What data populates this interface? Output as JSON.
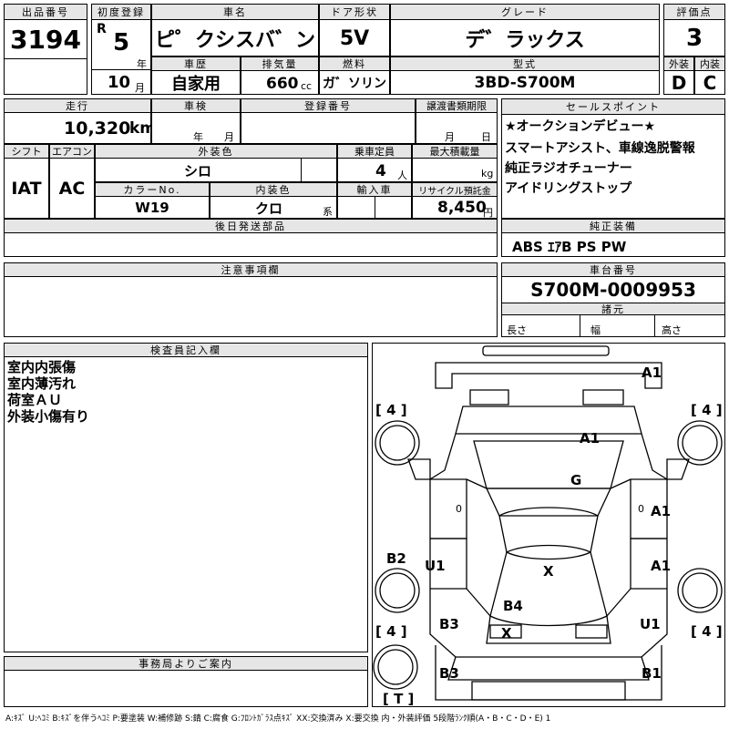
{
  "headers": {
    "lot_no": "出品番号",
    "first_reg": "初度登録",
    "car_name": "車名",
    "door_type": "ドア形状",
    "grade": "グレード",
    "rating": "評価点",
    "history": "車歴",
    "displacement": "排気量",
    "fuel": "燃料",
    "model": "型式",
    "exterior": "外装",
    "interior": "内装",
    "mileage": "走行",
    "inspection": "車検",
    "registration_no": "登録番号",
    "transfer_deadline": "譲渡書類期限",
    "sales_point": "セールスポイント",
    "shift": "シフト",
    "aircon": "エアコン",
    "exterior_color": "外装色",
    "capacity": "乗車定員",
    "max_load": "最大積載量",
    "color_no": "カラーNo.",
    "interior_color": "内装色",
    "import": "輸入車",
    "recycle": "リサイクル預託金",
    "later_parts": "後日発送部品",
    "genuine_equipment": "純正装備",
    "notes": "注意事項欄",
    "chassis_no": "車台番号",
    "specs": "諸元",
    "length": "長さ",
    "width": "幅",
    "height": "高さ",
    "inspector": "検査員記入欄",
    "office": "事務局よりご案内"
  },
  "values": {
    "lot_no": "3194",
    "era": "R",
    "year": "5",
    "year_unit": "年",
    "month": "10",
    "month_unit": "月",
    "car_name": "ピ゜クシスバ゛ン",
    "door_type": "5V",
    "grade": "デ゛ラックス",
    "rating": "3",
    "history": "自家用",
    "displacement": "660",
    "displacement_unit": "cc",
    "fuel": "ガ゛ソリン",
    "model": "3BD-S700M",
    "exterior": "D",
    "interior": "C",
    "mileage": "10,320",
    "mileage_unit": "km",
    "inspection_year_unit": "年",
    "inspection_month_unit": "月",
    "transfer_month_unit": "月",
    "transfer_day_unit": "日",
    "shift": "IAT",
    "aircon": "AC",
    "exterior_color": "シロ",
    "capacity": "4",
    "capacity_unit": "人",
    "max_load_unit": "kg",
    "color_no": "W19",
    "interior_color": "クロ",
    "interior_color_unit": "系",
    "recycle": "8,450",
    "recycle_unit": "円",
    "genuine_equipment": "ABS ｴｱB PS PW",
    "chassis_no": "S700M-0009953"
  },
  "sales_points": [
    "★オークションデビュー★",
    "スマートアシスト、車線逸脱警報",
    "純正ラジオチューナー",
    "アイドリングストップ"
  ],
  "inspector_notes": [
    "室内内張傷",
    "室内薄汚れ",
    "荷室ＡＵ",
    "外装小傷有り"
  ],
  "diagram": {
    "tire_fl": "[ 4 ]",
    "tire_fr": "[ 4 ]",
    "tire_rl": "[ 4 ]",
    "tire_rr": "[ 4 ]",
    "spare": "[ T ]",
    "rear_panel": "A1",
    "roof": "A1",
    "rear_glass": "G",
    "right_rear_door": "A1",
    "right_front_door": "A1",
    "left_side": "B2",
    "left_front_door": "U1",
    "hood": "X",
    "front_left_fender": "B3",
    "front_center": "B4",
    "front_right_fender": "U1",
    "grille": "X",
    "front_bumper_left": "B3",
    "front_bumper_right": "B1",
    "window_mark_left": "0",
    "window_mark_right": "0"
  },
  "legend": "A:ｷｽﾞ U:ﾍｺﾐ B:ｷｽﾞを伴うﾍｺﾐ P:要塗装 W:補修跡 S:錆 C:腐食 G:ﾌﾛﾝﾄｶﾞﾗｽ点ｷｽﾞ XX:交換済み X:要交換 内・外装評価 5段階ﾗﾝｸ順(A・B・C・D・E) 1"
}
